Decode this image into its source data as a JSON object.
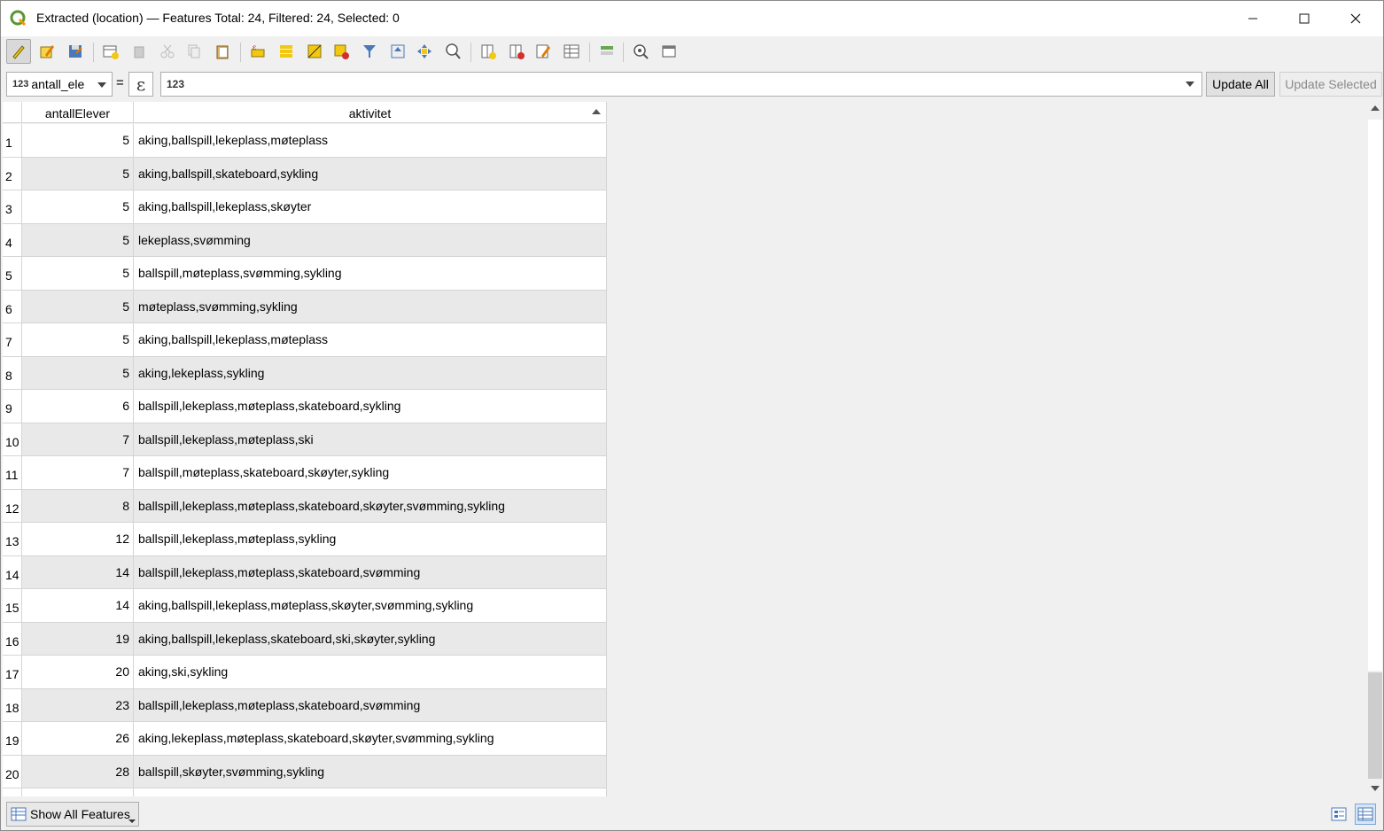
{
  "window": {
    "title": "Extracted (location) — Features Total: 24, Filtered: 24, Selected: 0",
    "minimize": "—",
    "maximize": "☐",
    "close": "✕"
  },
  "toolbar": {
    "icons": [
      "toggle-edit-icon",
      "multi-edit-icon",
      "save-edits-icon",
      "reload-icon",
      "add-feature-icon",
      "delete-feature-icon",
      "cut-icon",
      "copy-icon",
      "paste-icon",
      "select-expression-icon",
      "select-all-icon",
      "invert-selection-icon",
      "deselect-icon",
      "filter-icon",
      "move-top-icon",
      "pan-to-icon",
      "zoom-to-icon",
      "new-field-icon",
      "delete-field-icon",
      "field-calculator-icon",
      "conditional-format-icon",
      "dock-icon",
      "actions-icon"
    ]
  },
  "field_bar": {
    "field_type": "123",
    "field_name": "antall_ele",
    "equals": "=",
    "expression_icon": "ε",
    "expression_type": "123",
    "update_all": "Update All",
    "update_selected": "Update Selected"
  },
  "table": {
    "columns": [
      "antallElever",
      "aktivitet"
    ],
    "rows": [
      {
        "n": "1",
        "antall": "5",
        "aktivitet": "aking,ballspill,lekeplass,møteplass"
      },
      {
        "n": "2",
        "antall": "5",
        "aktivitet": "aking,ballspill,skateboard,sykling"
      },
      {
        "n": "3",
        "antall": "5",
        "aktivitet": "aking,ballspill,lekeplass,skøyter"
      },
      {
        "n": "4",
        "antall": "5",
        "aktivitet": "lekeplass,svømming"
      },
      {
        "n": "5",
        "antall": "5",
        "aktivitet": "ballspill,møteplass,svømming,sykling"
      },
      {
        "n": "6",
        "antall": "5",
        "aktivitet": "møteplass,svømming,sykling"
      },
      {
        "n": "7",
        "antall": "5",
        "aktivitet": "aking,ballspill,lekeplass,møteplass"
      },
      {
        "n": "8",
        "antall": "5",
        "aktivitet": "aking,lekeplass,sykling"
      },
      {
        "n": "9",
        "antall": "6",
        "aktivitet": "ballspill,lekeplass,møteplass,skateboard,sykling"
      },
      {
        "n": "10",
        "antall": "7",
        "aktivitet": "ballspill,lekeplass,møteplass,ski"
      },
      {
        "n": "11",
        "antall": "7",
        "aktivitet": "ballspill,møteplass,skateboard,skøyter,sykling"
      },
      {
        "n": "12",
        "antall": "8",
        "aktivitet": "ballspill,lekeplass,møteplass,skateboard,skøyter,svømming,sykling"
      },
      {
        "n": "13",
        "antall": "12",
        "aktivitet": "ballspill,lekeplass,møteplass,sykling"
      },
      {
        "n": "14",
        "antall": "14",
        "aktivitet": "ballspill,lekeplass,møteplass,skateboard,svømming"
      },
      {
        "n": "15",
        "antall": "14",
        "aktivitet": "aking,ballspill,lekeplass,møteplass,skøyter,svømming,sykling"
      },
      {
        "n": "16",
        "antall": "19",
        "aktivitet": "aking,ballspill,lekeplass,skateboard,ski,skøyter,sykling"
      },
      {
        "n": "17",
        "antall": "20",
        "aktivitet": "aking,ski,sykling"
      },
      {
        "n": "18",
        "antall": "23",
        "aktivitet": "ballspill,lekeplass,møteplass,skateboard,svømming"
      },
      {
        "n": "19",
        "antall": "26",
        "aktivitet": "aking,lekeplass,møteplass,skateboard,skøyter,svømming,sykling"
      },
      {
        "n": "20",
        "antall": "28",
        "aktivitet": "ballspill,skøyter,svømming,sykling"
      }
    ]
  },
  "status": {
    "show_all": "Show All Features"
  }
}
